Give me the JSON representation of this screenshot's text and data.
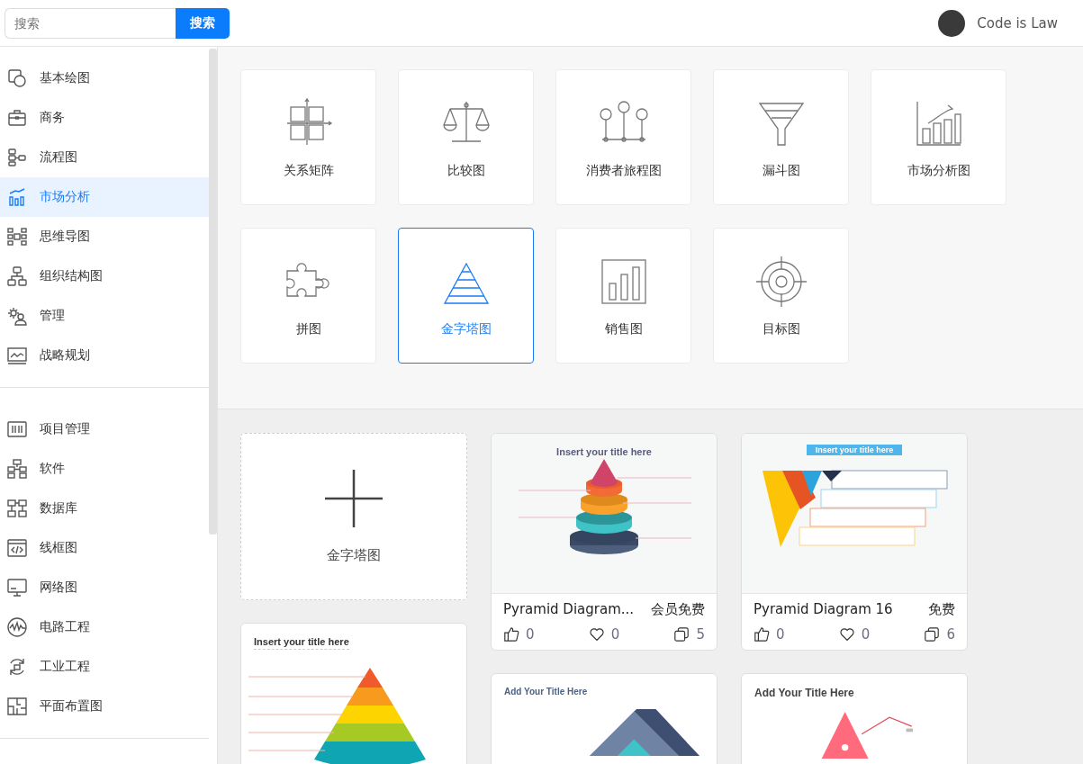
{
  "search": {
    "placeholder": "搜索",
    "button": "搜索"
  },
  "user": {
    "name": "Code is Law"
  },
  "sidebar": {
    "groups": [
      {
        "items": [
          {
            "label": "基本绘图",
            "selected": false
          },
          {
            "label": "商务",
            "selected": false
          },
          {
            "label": "流程图",
            "selected": false
          },
          {
            "label": "市场分析",
            "selected": true
          },
          {
            "label": "思维导图",
            "selected": false
          },
          {
            "label": "组织结构图",
            "selected": false
          },
          {
            "label": "管理",
            "selected": false
          },
          {
            "label": "战略规划",
            "selected": false
          }
        ]
      },
      {
        "items": [
          {
            "label": "项目管理",
            "selected": false
          },
          {
            "label": "软件",
            "selected": false
          },
          {
            "label": "数据库",
            "selected": false
          },
          {
            "label": "线框图",
            "selected": false
          },
          {
            "label": "网络图",
            "selected": false
          },
          {
            "label": "电路工程",
            "selected": false
          },
          {
            "label": "工业工程",
            "selected": false
          },
          {
            "label": "平面布置图",
            "selected": false
          }
        ]
      }
    ]
  },
  "categories": [
    {
      "label": "关系矩阵",
      "selected": false
    },
    {
      "label": "比较图",
      "selected": false
    },
    {
      "label": "消费者旅程图",
      "selected": false
    },
    {
      "label": "漏斗图",
      "selected": false
    },
    {
      "label": "市场分析图",
      "selected": false
    },
    {
      "label": "拼图",
      "selected": false
    },
    {
      "label": "金字塔图",
      "selected": true
    },
    {
      "label": "销售图",
      "selected": false
    },
    {
      "label": "目标图",
      "selected": false
    }
  ],
  "templates": {
    "columns": [
      {
        "cards": [
          {
            "kind": "new",
            "label": "金字塔图"
          },
          {
            "kind": "fan",
            "preview_title": "Insert your title here"
          }
        ]
      },
      {
        "cards": [
          {
            "kind": "cones",
            "preview_title": "Insert your title here",
            "title": "Pyramid Diagram...",
            "price": "会员免费",
            "likes": "0",
            "favorites": "0",
            "copies": "5"
          },
          {
            "kind": "blocks",
            "preview_title": "Add Your Title Here"
          }
        ]
      },
      {
        "cards": [
          {
            "kind": "inverted",
            "preview_title": "Insert your title here",
            "title": "Pyramid Diagram 16",
            "price": "免费",
            "likes": "0",
            "favorites": "0",
            "copies": "6"
          },
          {
            "kind": "triangle",
            "preview_title": "Add Your Title Here"
          }
        ]
      }
    ]
  }
}
